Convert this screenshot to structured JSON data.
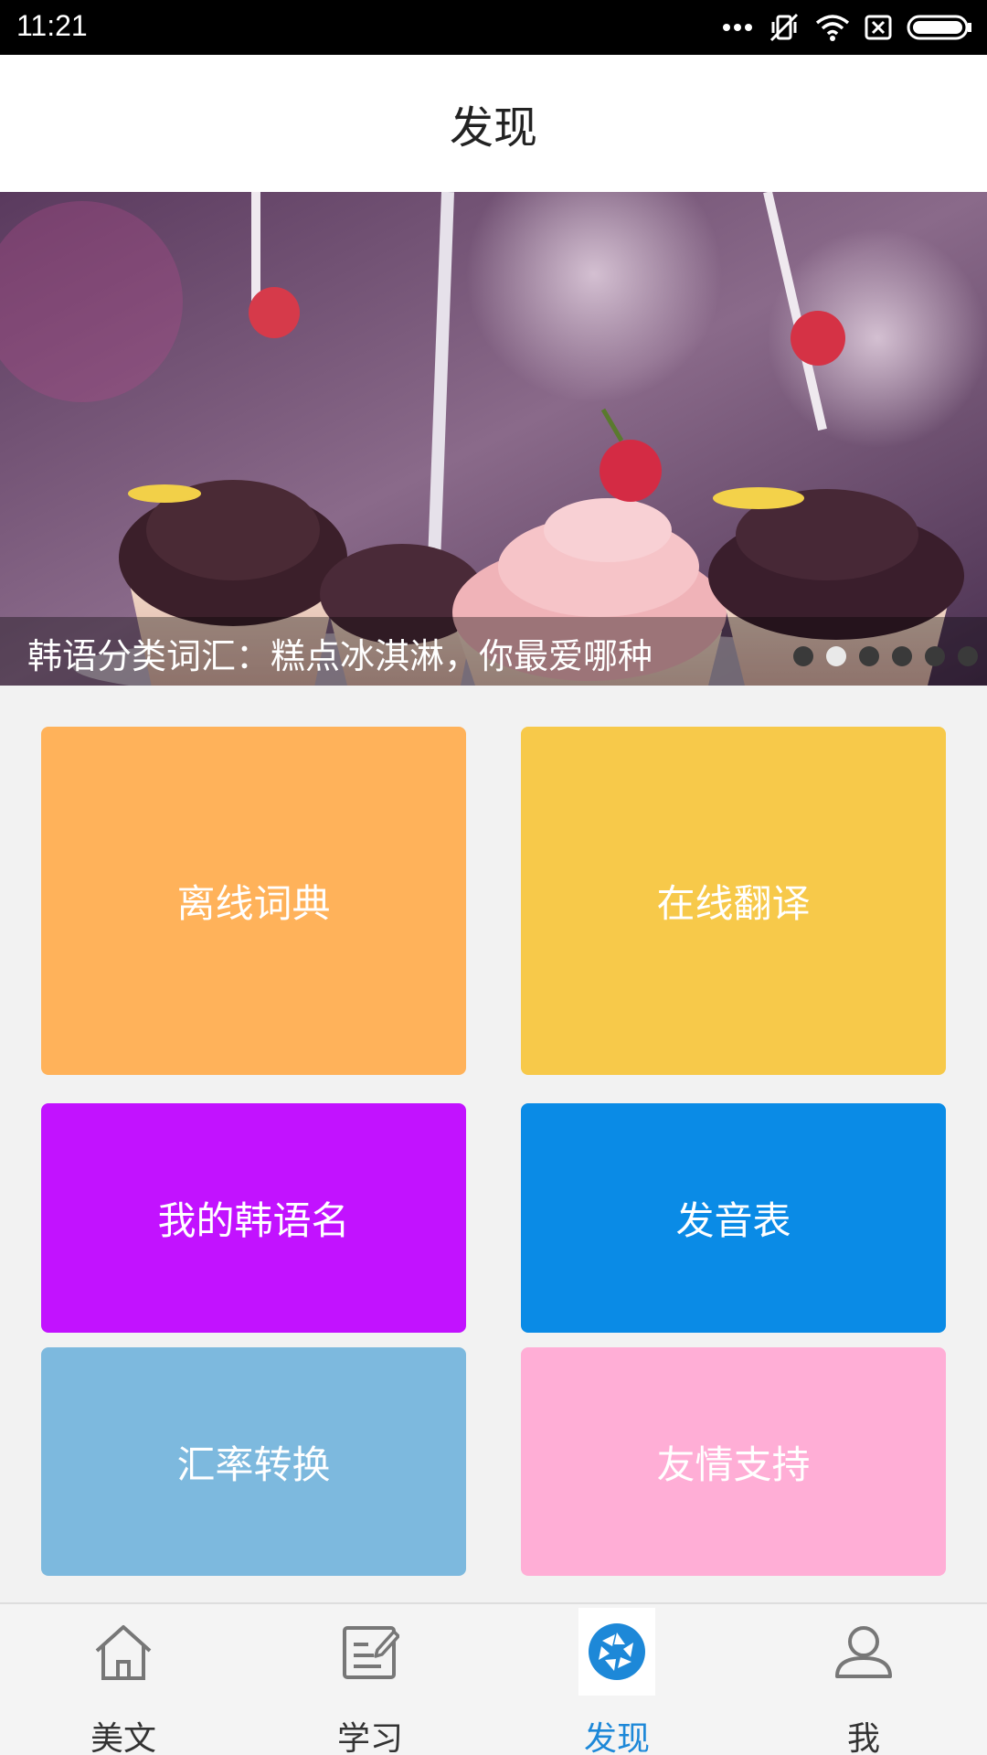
{
  "status_bar": {
    "time": "11:21",
    "icons": [
      "more-dots-icon",
      "vibrate-off-icon",
      "wifi-icon",
      "no-sim-icon",
      "battery-icon"
    ]
  },
  "header": {
    "title": "发现"
  },
  "banner": {
    "caption": "韩语分类词汇：糕点冰淇淋，你最爱哪种",
    "page_count": 6,
    "active_page": 2
  },
  "tiles": [
    {
      "label": "离线词典",
      "color": "#ffb25a"
    },
    {
      "label": "在线翻译",
      "color": "#f7c94a"
    },
    {
      "label": "我的韩语名",
      "color": "#c212ff"
    },
    {
      "label": "发音表",
      "color": "#0a8be6"
    },
    {
      "label": "汇率转换",
      "color": "#7db9de"
    },
    {
      "label": "友情支持",
      "color": "#ffaed6"
    }
  ],
  "bottom_nav": {
    "items": [
      {
        "label": "美文",
        "icon": "home-icon"
      },
      {
        "label": "学习",
        "icon": "edit-icon"
      },
      {
        "label": "发现",
        "icon": "aperture-icon",
        "active": true
      },
      {
        "label": "我",
        "icon": "user-icon"
      }
    ],
    "active_color": "#1d88d8"
  }
}
